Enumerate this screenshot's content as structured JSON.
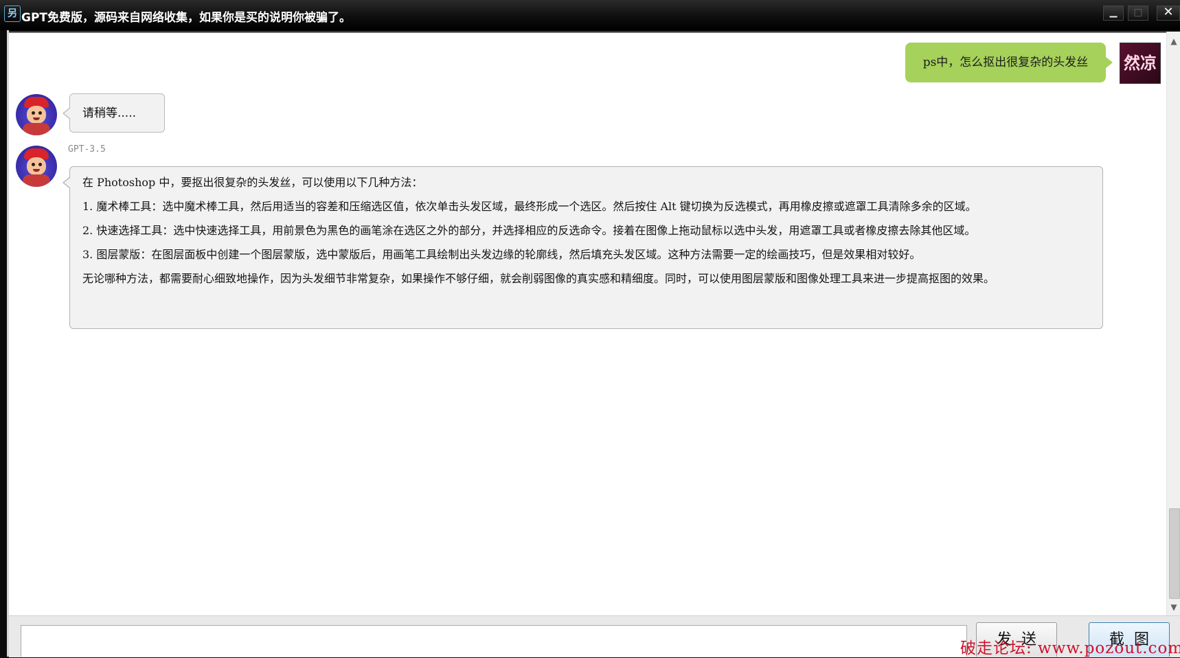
{
  "window": {
    "title": "GPT免费版，源码来自网络收集，如果你是买的说明你被骗了。",
    "icon": "app-icon",
    "minimize_glyph": "▁",
    "maximize_glyph": "□",
    "close_glyph": "✕"
  },
  "conversation": {
    "user_message": "ps中，怎么抠出很复杂的头发丝",
    "user_avatar_text": "然凉",
    "waiting_text": "请稍等.....",
    "model_label": "GPT-3.5",
    "answer_paragraphs": [
      "在 Photoshop 中，要抠出很复杂的头发丝，可以使用以下几种方法：",
      "1. 魔术棒工具：选中魔术棒工具，然后用适当的容差和压缩选区值，依次单击头发区域，最终形成一个选区。然后按住 Alt 键切换为反选模式，再用橡皮擦或遮罩工具清除多余的区域。",
      "2. 快速选择工具：选中快速选择工具，用前景色为黑色的画笔涂在选区之外的部分，并选择相应的反选命令。接着在图像上拖动鼠标以选中头发，用遮罩工具或者橡皮擦去除其他区域。",
      "3. 图层蒙版：在图层面板中创建一个图层蒙版，选中蒙版后，用画笔工具绘制出头发边缘的轮廓线，然后填充头发区域。这种方法需要一定的绘画技巧，但是效果相对较好。",
      "无论哪种方法，都需要耐心细致地操作，因为头发细节非常复杂，如果操作不够仔细，就会削弱图像的真实感和精细度。同时，可以使用图层蒙版和图像处理工具来进一步提高抠图的效果。"
    ]
  },
  "scrollbar": {
    "up_glyph": "▲",
    "down_glyph": "▼"
  },
  "input": {
    "value": "",
    "send_label": "发送",
    "screenshot_label": "截图"
  },
  "watermark": "破走论坛: www.pozout.com"
}
